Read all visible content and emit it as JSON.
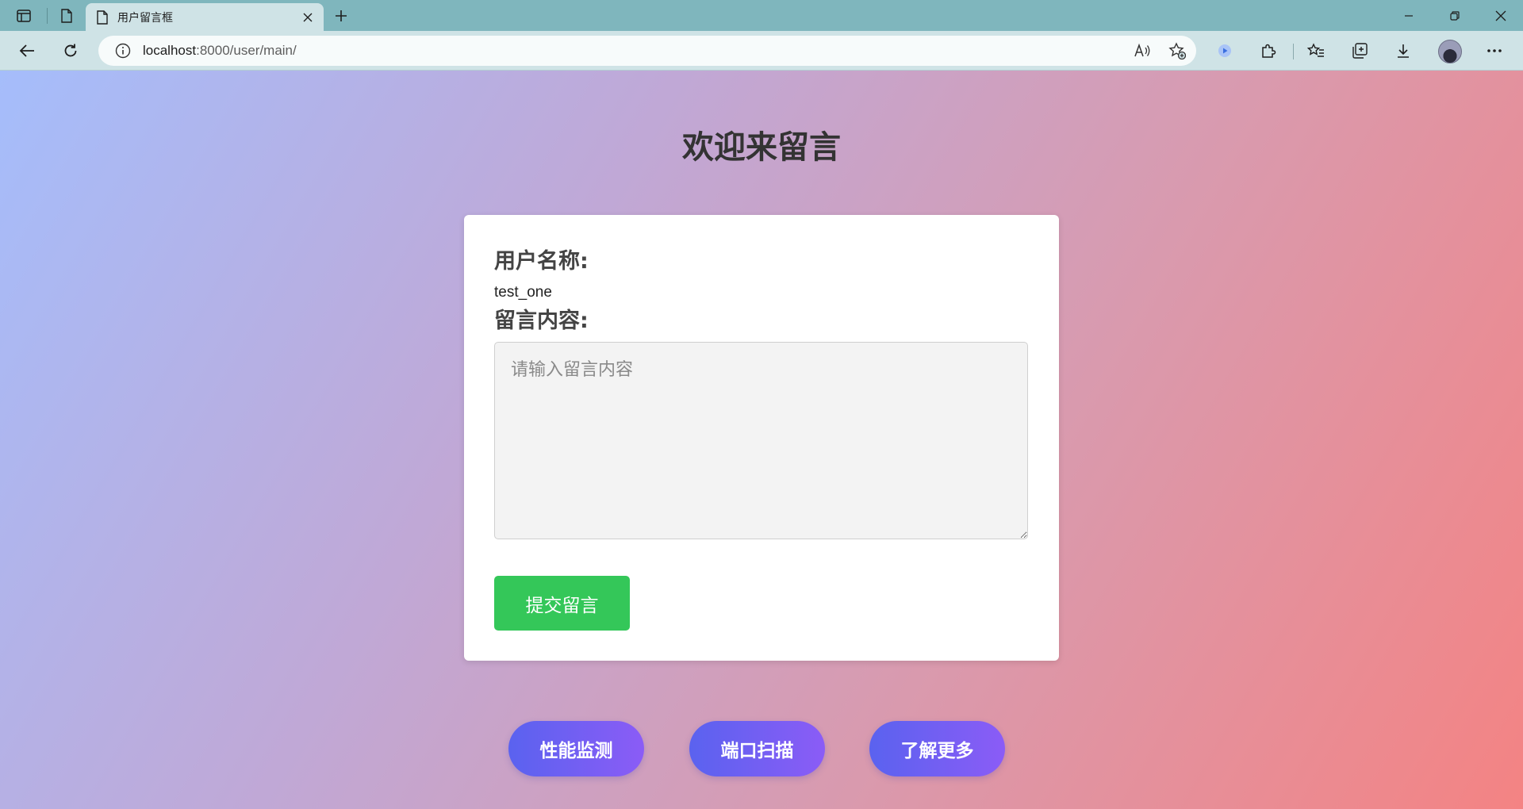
{
  "browser": {
    "tab_title": "用户留言框",
    "url_host": "localhost",
    "url_rest": ":8000/user/main/"
  },
  "page": {
    "title": "欢迎来留言",
    "username_label": "用户名称:",
    "username_value": "test_one",
    "message_label": "留言内容:",
    "message_placeholder": "请输入留言内容",
    "submit_label": "提交留言"
  },
  "footer_buttons": [
    {
      "label": "性能监测"
    },
    {
      "label": "端口扫描"
    },
    {
      "label": "了解更多"
    }
  ],
  "colors": {
    "submit_button": "#34c759",
    "pill_gradient_start": "#5a62ef",
    "pill_gradient_end": "#8b5cf6",
    "background_gradient_start": "#a5bdfb",
    "background_gradient_end": "#f48383"
  }
}
